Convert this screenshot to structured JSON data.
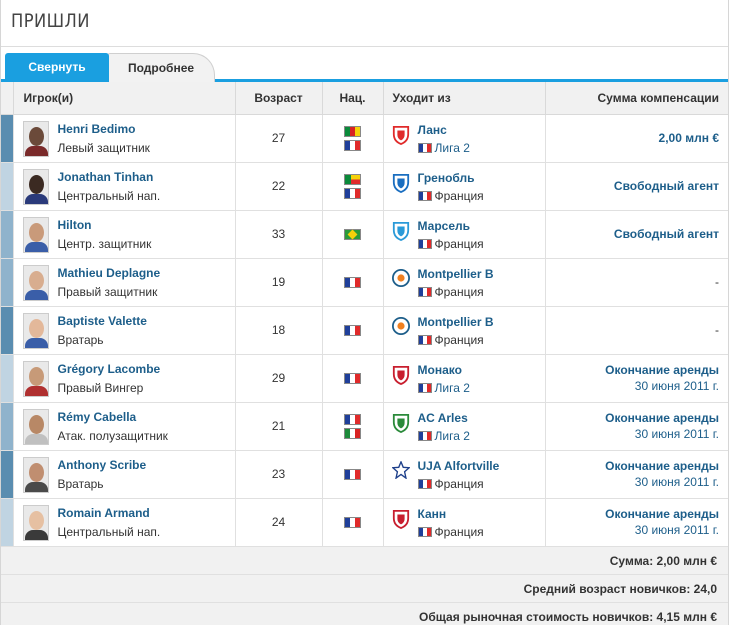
{
  "title": "Пришли",
  "tabs": {
    "collapse": "Свернуть",
    "more": "Подробнее"
  },
  "columns": {
    "player": "Игрок(и)",
    "age": "Возраст",
    "nat": "Нац.",
    "from": "Уходит из",
    "fee": "Сумма компенсации"
  },
  "rows": [
    {
      "name": "Henri Bedimo",
      "position": "Левый защитник",
      "age": "27",
      "nat": [
        "cm",
        "fr"
      ],
      "club": "Ланс",
      "league": "Лига 2",
      "league_flag": "fr",
      "fee": "2,00 млн €",
      "fee_sub": ""
    },
    {
      "name": "Jonathan Tinhan",
      "position": "Центральный нап.",
      "age": "22",
      "nat": [
        "bj",
        "fr"
      ],
      "club": "Гренобль",
      "league": "Франция",
      "league_flag": "fr",
      "fee": "Свободный агент",
      "fee_sub": ""
    },
    {
      "name": "Hilton",
      "position": "Центр. защитник",
      "age": "33",
      "nat": [
        "br"
      ],
      "club": "Марсель",
      "league": "Франция",
      "league_flag": "fr",
      "fee": "Свободный агент",
      "fee_sub": ""
    },
    {
      "name": "Mathieu Deplagne",
      "position": "Правый защитник",
      "age": "19",
      "nat": [
        "fr"
      ],
      "club": "Montpellier B",
      "league": "Франция",
      "league_flag": "fr",
      "fee": "-",
      "fee_sub": ""
    },
    {
      "name": "Baptiste Valette",
      "position": "Вратарь",
      "age": "18",
      "nat": [
        "fr"
      ],
      "club": "Montpellier B",
      "league": "Франция",
      "league_flag": "fr",
      "fee": "-",
      "fee_sub": ""
    },
    {
      "name": "Grégory Lacombe",
      "position": "Правый Вингер",
      "age": "29",
      "nat": [
        "fr"
      ],
      "club": "Монако",
      "league": "Лига 2",
      "league_flag": "fr",
      "fee": "Окончание аренды",
      "fee_sub": "30 июня 2011 г."
    },
    {
      "name": "Rémy Cabella",
      "position": "Атак. полузащитник",
      "age": "21",
      "nat": [
        "fr",
        "it"
      ],
      "club": "AC Arles",
      "league": "Лига 2",
      "league_flag": "fr",
      "fee": "Окончание аренды",
      "fee_sub": "30 июня 2011 г."
    },
    {
      "name": "Anthony Scribe",
      "position": "Вратарь",
      "age": "23",
      "nat": [
        "fr"
      ],
      "club": "UJA Alfortville",
      "league": "Франция",
      "league_flag": "fr",
      "fee": "Окончание аренды",
      "fee_sub": "30 июня 2011 г."
    },
    {
      "name": "Romain Armand",
      "position": "Центральный нап.",
      "age": "24",
      "nat": [
        "fr"
      ],
      "club": "Канн",
      "league": "Франция",
      "league_flag": "fr",
      "fee": "Окончание аренды",
      "fee_sub": "30 июня 2011 г."
    }
  ],
  "footer": {
    "sum": "Сумма: 2,00 млн €",
    "avg_age": "Средний возраст новичков: 24,0",
    "market_value": "Общая рыночная стоимость новичков: 4,15 млн €"
  },
  "colors": {
    "accent": "#1a9fe0",
    "link": "#1d5e8a",
    "header_bg": "#f1f1f1"
  }
}
